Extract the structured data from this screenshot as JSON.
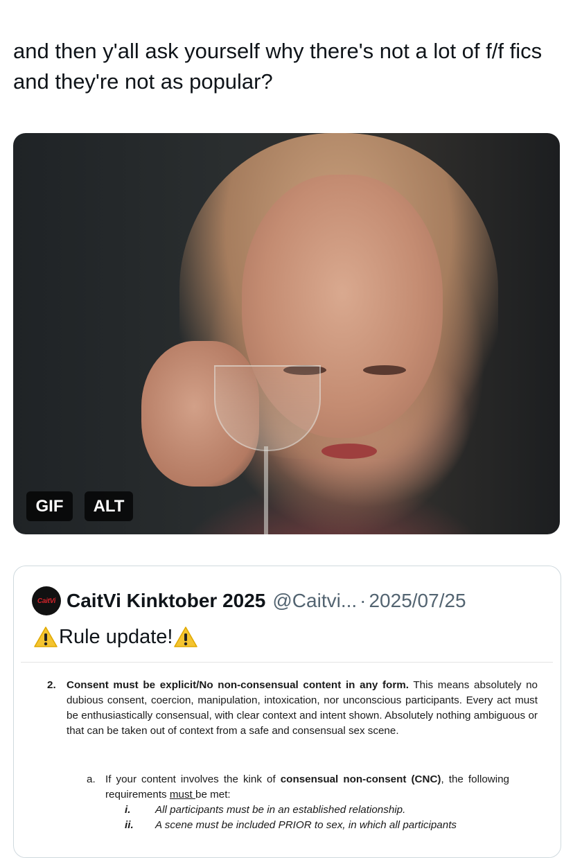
{
  "post": {
    "text": "and then y'all ask yourself why there's not a lot of f/f fics and they're not as popular?"
  },
  "media": {
    "gif_badge": "GIF",
    "alt_badge": "ALT"
  },
  "quote": {
    "avatar_text": "CaitVi",
    "name": "CaitVi Kinktober 2025",
    "handle": "@Caitvi...",
    "separator": "·",
    "date": "2025/07/25",
    "text": "Rule update!",
    "document": {
      "item_number": "2.",
      "item_bold": "Consent must be explicit/No non-consensual content in any form.",
      "item_rest": " This means absolutely no dubious consent, coercion, manipulation, intoxication, nor unconscious participants. Every act must be enthusiastically consensual, with clear context and intent shown. Absolutely nothing ambiguous or that can be taken out of context from a safe and consensual sex scene.",
      "sub_letter": "a.",
      "sub_pre": "If your content involves the kink of ",
      "sub_bold": "consensual non-consent (CNC)",
      "sub_mid": ", the following requirements ",
      "sub_underline": "must ",
      "sub_post": "be met:",
      "roman": [
        {
          "numeral": "i.",
          "text": "All participants must be in an established relationship."
        },
        {
          "numeral": "ii.",
          "text": "A scene must be included PRIOR to sex, in which all participants"
        }
      ]
    }
  },
  "colors": {
    "text": "#0f1419",
    "secondary": "#536471",
    "border": "#cfd9de",
    "warning": "#f4c430"
  },
  "icons": {
    "warning": "warning-icon"
  }
}
